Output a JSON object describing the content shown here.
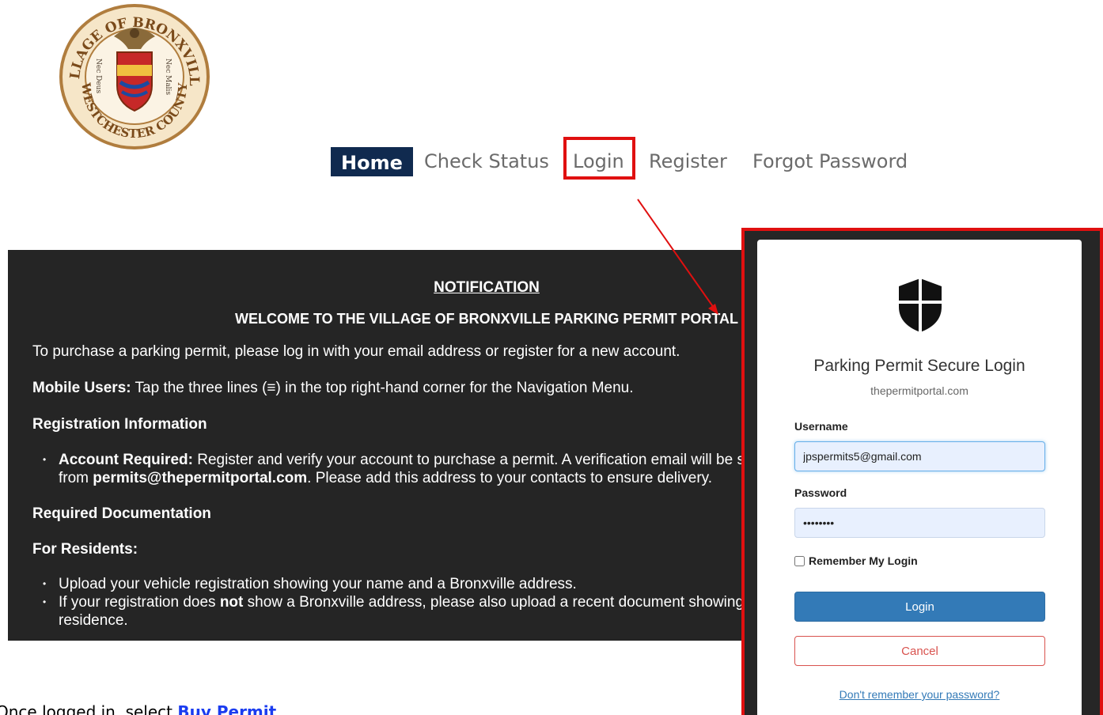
{
  "seal": {
    "text_top": "VILLAGE OF BRONXVILLE",
    "text_bottom": "WESTCHESTER COUNTY",
    "motto_left": "Nec Deus",
    "motto_right": "Nec Malis"
  },
  "nav": {
    "home": "Home",
    "check_status": "Check Status",
    "login": "Login",
    "register": "Register",
    "forgot_password": "Forgot Password"
  },
  "notice": {
    "heading": "NOTIFICATION",
    "welcome": "WELCOME TO THE VILLAGE OF BRONXVILLE PARKING PERMIT PORTAL",
    "intro": "To purchase a parking permit, please log in with your email address or register for a new account.",
    "mobile_label": "Mobile Users:",
    "mobile_text": " Tap the three lines (≡) in the top right-hand corner for the Navigation Menu.",
    "reg_heading": "Registration Information",
    "account_label": "Account Required:",
    "account_text": " Register and verify your account to purchase a permit. A verification email will be sent",
    "account_from": "from ",
    "account_email": "permits@thepermitportal.com",
    "account_rest": ". Please add this address to your contacts to ensure delivery.",
    "doc_heading": "Required Documentation",
    "residents_heading": "For Residents:",
    "bullet1": "Upload your vehicle registration showing your name and a Bronxville address.",
    "bullet2_a": "If your registration does ",
    "bullet2_not": "not",
    "bullet2_b": " show a Bronxville address, please also upload a recent document showing proof of",
    "bullet2_c": "residence."
  },
  "footer": {
    "prefix": "Once logged in, select ",
    "link": "Buy Permit"
  },
  "login": {
    "title": "Parking Permit Secure Login",
    "subtitle": "thepermitportal.com",
    "username_label": "Username",
    "username_value": "jpspermits5@gmail.com",
    "password_label": "Password",
    "password_value": "••••••••",
    "remember_label": "Remember My Login",
    "remember_checked": false,
    "login_button": "Login",
    "cancel_button": "Cancel",
    "forgot_link": "Don't remember your password?"
  },
  "colors": {
    "nav_home_bg": "#102a4f",
    "highlight_red": "#e01010",
    "notice_bg": "#252525",
    "login_button": "#337ab7",
    "cancel_red": "#d9534f",
    "footer_link": "#1a3cf0"
  }
}
